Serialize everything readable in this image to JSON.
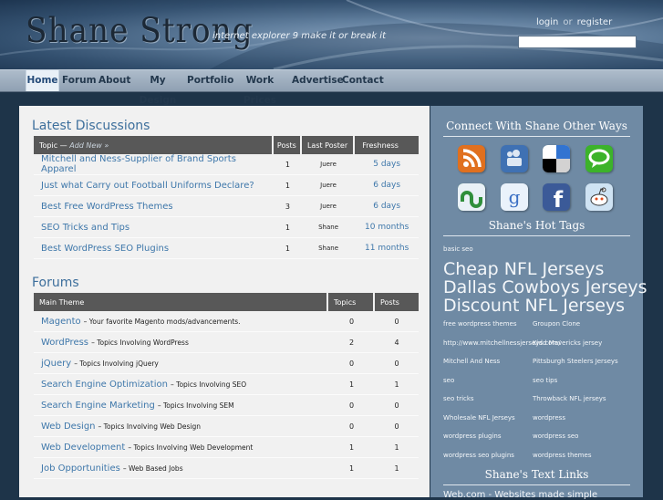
{
  "header": {
    "site_title": "Shane Strong",
    "tagline": "internet explorer 9 make it or break it",
    "login_label": "login",
    "or_label": "or",
    "register_label": "register",
    "search_value": ""
  },
  "nav": {
    "items": [
      {
        "label": "Home",
        "active": true
      },
      {
        "label": "Forum"
      },
      {
        "label": "About"
      },
      {
        "label": "My Design"
      },
      {
        "label": "Portfolio"
      },
      {
        "label": "Work Prices"
      },
      {
        "label": "Advertise"
      },
      {
        "label": "Contact"
      }
    ]
  },
  "latest": {
    "heading": "Latest Discussions",
    "columns": {
      "topic": "Topic —",
      "add_new": "Add New »",
      "posts": "Posts",
      "last_poster": "Last Poster",
      "freshness": "Freshness"
    },
    "rows": [
      {
        "title": "Mitchell and Ness-Supplier of Brand Sports Apparel",
        "posts": "1",
        "poster": "Juere",
        "freshness": "5 days"
      },
      {
        "title": "Just what Carry out Football Uniforms Declare?",
        "posts": "1",
        "poster": "Juere",
        "freshness": "6 days"
      },
      {
        "title": "Best Free WordPress Themes",
        "posts": "3",
        "poster": "Juere",
        "freshness": "6 days"
      },
      {
        "title": "SEO Tricks and Tips",
        "posts": "1",
        "poster": "Shane",
        "freshness": "10 months"
      },
      {
        "title": "Best WordPress SEO Plugins",
        "posts": "1",
        "poster": "Shane",
        "freshness": "11 months"
      }
    ]
  },
  "forums": {
    "heading": "Forums",
    "columns": {
      "theme": "Main Theme",
      "topics": "Topics",
      "posts": "Posts"
    },
    "rows": [
      {
        "name": "Magento",
        "desc": "– Your favorite Magento mods/advancements.",
        "topics": "0",
        "posts": "0"
      },
      {
        "name": "WordPress",
        "desc": "– Topics Involving WordPress",
        "topics": "2",
        "posts": "4"
      },
      {
        "name": "jQuery",
        "desc": "– Topics Involving jQuery",
        "topics": "0",
        "posts": "0"
      },
      {
        "name": "Search Engine Optimization",
        "desc": "– Topics Involving SEO",
        "topics": "1",
        "posts": "1"
      },
      {
        "name": "Search Engine Marketing",
        "desc": "– Topics Involving SEM",
        "topics": "0",
        "posts": "0"
      },
      {
        "name": "Web Design",
        "desc": "– Topics Involving Web Design",
        "topics": "0",
        "posts": "0"
      },
      {
        "name": "Web Development",
        "desc": "– Topics Involving Web Development",
        "topics": "1",
        "posts": "1"
      },
      {
        "name": "Job Opportunities",
        "desc": "– Web Based Jobs",
        "topics": "1",
        "posts": "1"
      }
    ]
  },
  "sidebar": {
    "connect_heading": "Connect With Shane Other Ways",
    "social": [
      {
        "icon": "rss-icon",
        "color": "#e0701f"
      },
      {
        "icon": "myspace-icon",
        "color": "#3f71b3"
      },
      {
        "icon": "delicious-icon",
        "color": "#ffffff"
      },
      {
        "icon": "chat-bubble-icon",
        "color": "#3cb32a"
      },
      {
        "icon": "stumbleupon-icon",
        "color": "#2f8f3b"
      },
      {
        "icon": "google-icon",
        "color": "#eaf2fb"
      },
      {
        "icon": "facebook-icon",
        "color": "#3b5a98"
      },
      {
        "icon": "reddit-icon",
        "color": "#cfe3f3"
      }
    ],
    "tags_heading": "Shane's Hot Tags",
    "tags": [
      {
        "label": "basic seo",
        "size": "small"
      },
      {
        "label": "Cheap NFL Jerseys",
        "size": "big"
      },
      {
        "label": "Dallas Cowboys Jerseys",
        "size": "big"
      },
      {
        "label": "Discount NFL Jerseys",
        "size": "big"
      },
      {
        "label": "free wordpress themes",
        "size": "small"
      },
      {
        "label": "Groupon Clone",
        "size": "small"
      },
      {
        "label": "http://www.mitchellnessjerseys.com/",
        "size": "small"
      },
      {
        "label": "Kidd Mavericks jersey",
        "size": "small"
      },
      {
        "label": "Mitchell And Ness",
        "size": "small"
      },
      {
        "label": "Pittsburgh Steelers Jerseys",
        "size": "small"
      },
      {
        "label": "seo",
        "size": "small"
      },
      {
        "label": "seo tips",
        "size": "small"
      },
      {
        "label": "seo tricks",
        "size": "small"
      },
      {
        "label": "Throwback NFL jerseys",
        "size": "small"
      },
      {
        "label": "Wholesale NFL Jerseys",
        "size": "small"
      },
      {
        "label": "wordpress",
        "size": "small"
      },
      {
        "label": "wordpress plugins",
        "size": "small"
      },
      {
        "label": "wordpress seo",
        "size": "small"
      },
      {
        "label": "wordpress seo plugins",
        "size": "small"
      },
      {
        "label": "wordpress themes",
        "size": "small"
      }
    ],
    "links_heading": "Shane's Text Links",
    "links": [
      {
        "label": "Web.com - Websites made simple"
      }
    ]
  }
}
